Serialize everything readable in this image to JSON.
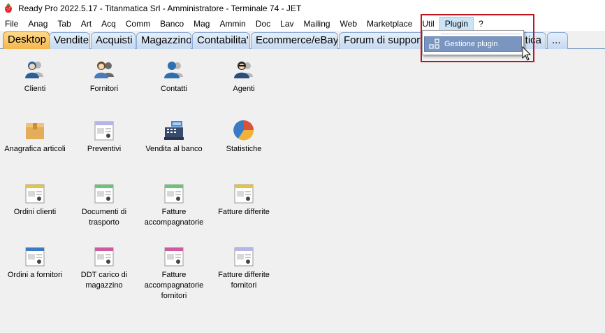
{
  "window": {
    "title": "Ready Pro 2022.5.17 - Titanmatica Srl - Amministratore - Terminale 74 - JET"
  },
  "menubar": {
    "items": [
      {
        "label": "File"
      },
      {
        "label": "Anag"
      },
      {
        "label": "Tab"
      },
      {
        "label": "Art"
      },
      {
        "label": "Acq"
      },
      {
        "label": "Comm"
      },
      {
        "label": "Banco"
      },
      {
        "label": "Mag"
      },
      {
        "label": "Ammin"
      },
      {
        "label": "Doc"
      },
      {
        "label": "Lav"
      },
      {
        "label": "Mailing"
      },
      {
        "label": "Web"
      },
      {
        "label": "Marketplace"
      },
      {
        "label": "Util"
      },
      {
        "label": "Plugin"
      },
      {
        "label": "?"
      }
    ]
  },
  "tabs": [
    {
      "label": "Desktop"
    },
    {
      "label": "Vendite"
    },
    {
      "label": "Acquisti"
    },
    {
      "label": "Magazzino"
    },
    {
      "label": "Contabilita'"
    },
    {
      "label": "Ecommerce/eBay"
    },
    {
      "label": "Forum di support"
    },
    {
      "label": "tica"
    },
    {
      "label": "..."
    }
  ],
  "plugin_menu": {
    "items": [
      {
        "label": "Gestione plugin",
        "icon": "grid-icon"
      }
    ]
  },
  "desktop": {
    "tiles": [
      {
        "label": "Clienti",
        "icon": "customer-icon"
      },
      {
        "label": "Fornitori",
        "icon": "supplier-icon"
      },
      {
        "label": "Contatti",
        "icon": "contacts-icon"
      },
      {
        "label": "Agenti",
        "icon": "agent-icon"
      },
      {
        "label": "Anagrafica articoli",
        "icon": "box-icon"
      },
      {
        "label": "Preventivi",
        "icon": "document-icon"
      },
      {
        "label": "Vendita al banco",
        "icon": "cash-register-icon"
      },
      {
        "label": "Statistiche",
        "icon": "pie-chart-icon"
      },
      {
        "label": "Ordini clienti",
        "icon": "document-icon"
      },
      {
        "label": "Documenti di trasporto",
        "icon": "document-icon"
      },
      {
        "label": "Fatture accompagnatorie",
        "icon": "document-icon"
      },
      {
        "label": "Fatture differite",
        "icon": "document-icon"
      },
      {
        "label": "Ordini a fornitori",
        "icon": "document-icon"
      },
      {
        "label": "DDT carico di magazzino",
        "icon": "document-icon"
      },
      {
        "label": "Fatture accompagnatorie fornitori",
        "icon": "document-icon"
      },
      {
        "label": "Fatture differite fornitori",
        "icon": "document-icon"
      }
    ]
  }
}
